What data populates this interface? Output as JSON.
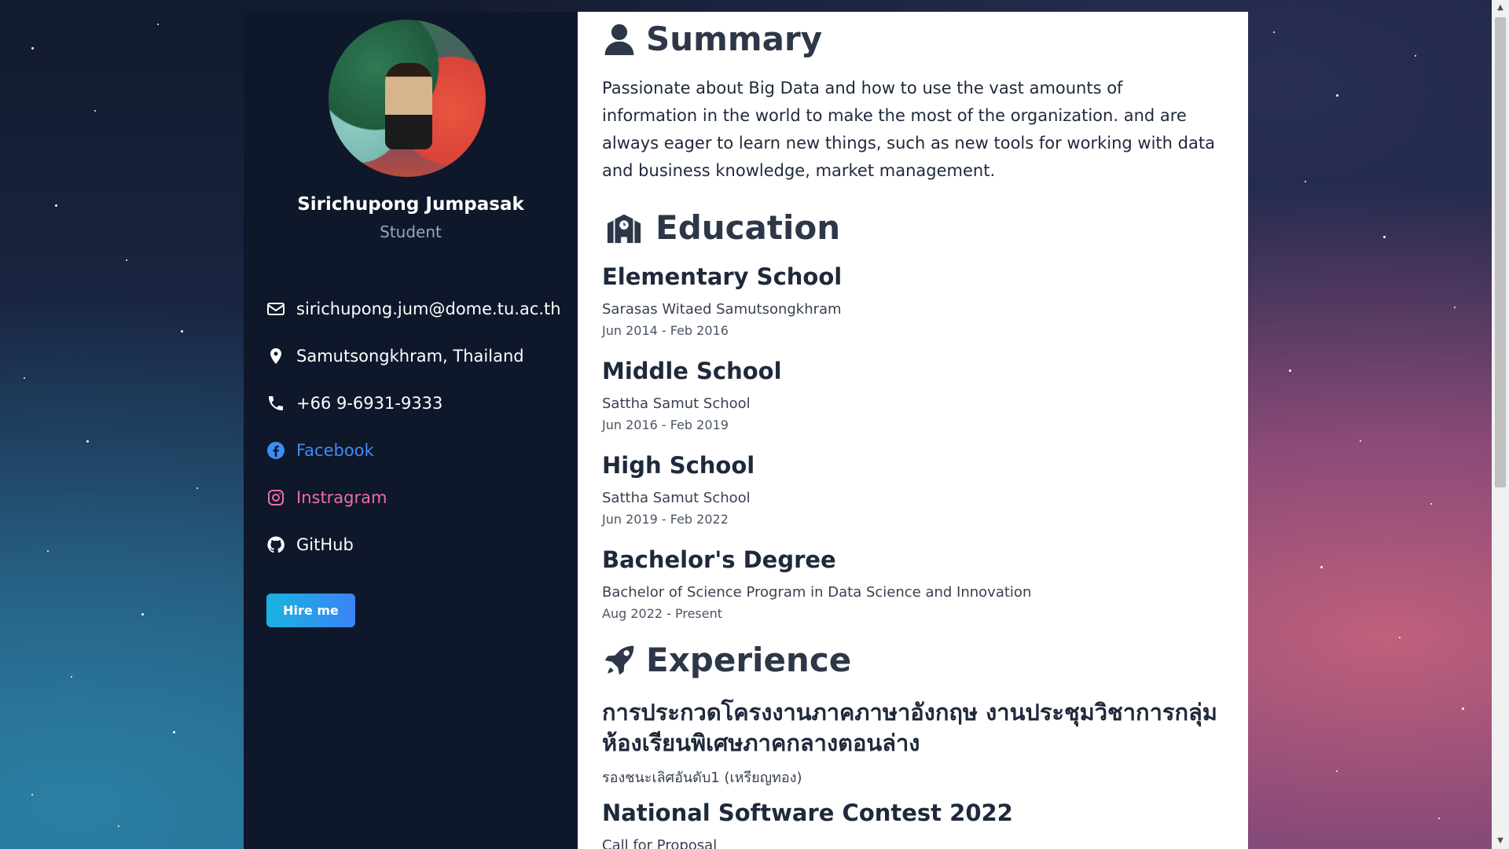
{
  "profile": {
    "name": "Sirichupong Jumpasak",
    "role": "Student"
  },
  "contacts": {
    "email": "sirichupong.jum@dome.tu.ac.th",
    "location": "Samutsongkhram, Thailand",
    "phone": "+66 9-6931-9333",
    "facebook": "Facebook",
    "instagram": "Instragram",
    "github": "GitHub"
  },
  "hire_button": "Hire me",
  "summary": {
    "title": "Summary",
    "text": "Passionate about Big Data and how to use the vast amounts of information in the world to make the most of the organization. and are always eager to learn new things, such as new tools for working with data and business knowledge, market management."
  },
  "education": {
    "title": "Education",
    "items": [
      {
        "level": "Elementary School",
        "school": "Sarasas Witaed Samutsongkhram",
        "dates": "Jun 2014 - Feb 2016"
      },
      {
        "level": "Middle School",
        "school": "Sattha Samut School",
        "dates": "Jun 2016 - Feb 2019"
      },
      {
        "level": "High School",
        "school": "Sattha Samut School",
        "dates": "Jun 2019 - Feb 2022"
      },
      {
        "level": "Bachelor's Degree",
        "school": "Bachelor of Science Program in Data Science and Innovation",
        "dates": "Aug 2022 - Present"
      }
    ]
  },
  "experience": {
    "title": "Experience",
    "items": [
      {
        "title": "การประกวดโครงงานภาคภาษาอังกฤษ งานประชุมวิชาการกลุ่มห้องเรียนพิเศษภาคกลางตอนล่าง",
        "detail": "รองชนะเลิศอันดับ1 (เหรียญทอง)"
      },
      {
        "title": "National Software Contest 2022",
        "detail": "Call for Proposal"
      }
    ]
  },
  "icons": {
    "summary": "user-icon",
    "education": "school-icon",
    "experience": "rocket-icon"
  },
  "colors": {
    "sidebar_bg": "#0f172a",
    "facebook": "#3f8cf2",
    "instagram": "#ec6fa4",
    "hire_gradient_start": "#19b4e0",
    "hire_gradient_end": "#3b82f6"
  }
}
